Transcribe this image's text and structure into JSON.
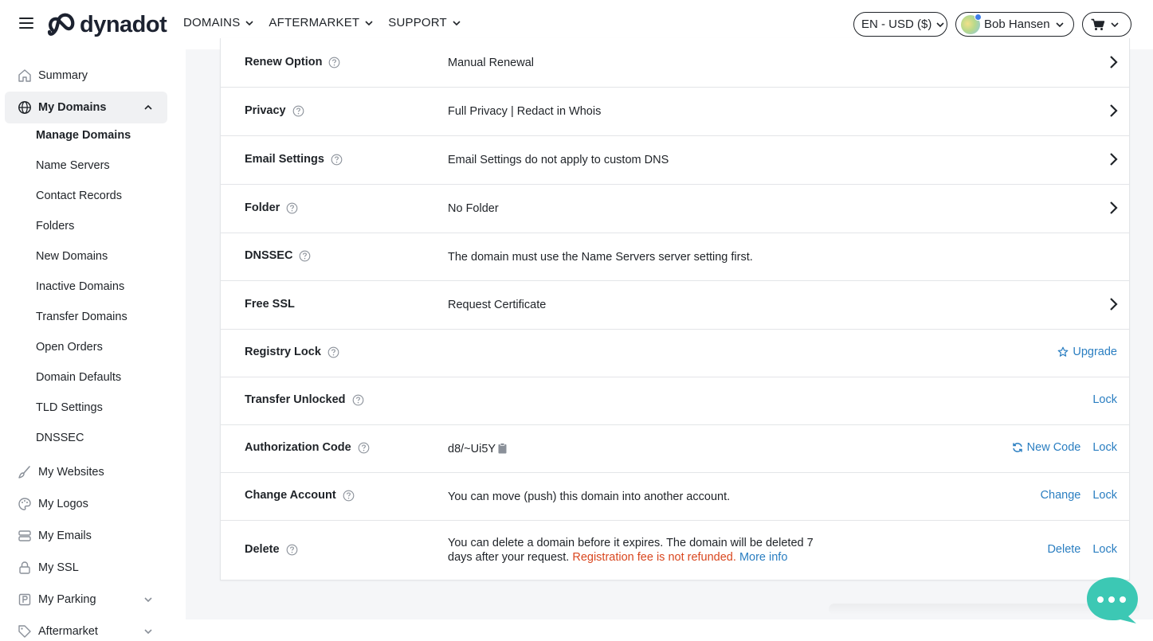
{
  "header": {
    "logo_text": "dynadot",
    "nav": [
      {
        "label": "DOMAINS"
      },
      {
        "label": "AFTERMARKET"
      },
      {
        "label": "SUPPORT"
      }
    ],
    "language_currency": "EN - USD ($)",
    "user_name": "Bob Hansen",
    "icons": {
      "menu": "hamburger-icon",
      "cart": "cart-icon",
      "dropdown": "chevron-down-icon"
    }
  },
  "sidebar": {
    "items": [
      {
        "label": "Summary",
        "icon": "home-icon"
      },
      {
        "label": "My Domains",
        "icon": "globe-icon",
        "expanded": true
      },
      {
        "label": "My Websites",
        "icon": "brush-icon"
      },
      {
        "label": "My Logos",
        "icon": "palette-icon"
      },
      {
        "label": "My Emails",
        "icon": "server-icon"
      },
      {
        "label": "My SSL",
        "icon": "lock-icon"
      },
      {
        "label": "My Parking",
        "icon": "parking-icon"
      },
      {
        "label": "Aftermarket",
        "icon": "tag-icon"
      }
    ],
    "domains_submenu": [
      {
        "label": "Manage Domains",
        "current": true
      },
      {
        "label": "Name Servers"
      },
      {
        "label": "Contact Records"
      },
      {
        "label": "Folders"
      },
      {
        "label": "New Domains"
      },
      {
        "label": "Inactive Domains"
      },
      {
        "label": "Transfer Domains"
      },
      {
        "label": "Open Orders"
      },
      {
        "label": "Domain Defaults"
      },
      {
        "label": "TLD Settings"
      },
      {
        "label": "DNSSEC"
      }
    ]
  },
  "settings": {
    "renew_option": {
      "label": "Renew Option",
      "value": "Manual Renewal"
    },
    "privacy": {
      "label": "Privacy",
      "value": "Full Privacy | Redact in Whois"
    },
    "email_settings": {
      "label": "Email Settings",
      "value": "Email Settings do not apply to custom DNS"
    },
    "folder": {
      "label": "Folder",
      "value": "No Folder"
    },
    "dnssec": {
      "label": "DNSSEC",
      "value": "The domain must use the Name Servers server setting first."
    },
    "free_ssl": {
      "label": "Free SSL",
      "value": "Request Certificate"
    },
    "registry_lock": {
      "label": "Registry Lock",
      "action": "Upgrade"
    },
    "transfer_unlocked": {
      "label": "Transfer Unlocked",
      "action": "Lock"
    },
    "authorization_code": {
      "label": "Authorization Code",
      "value": "d8/~Ui5Y",
      "new_code": "New Code",
      "lock": "Lock"
    },
    "change_account": {
      "label": "Change Account",
      "value": "You can move (push) this domain into another account.",
      "change": "Change",
      "lock": "Lock"
    },
    "delete": {
      "label": "Delete",
      "line1": "You can delete a domain before it expires. The domain will be deleted 7",
      "line2": "days after your request.",
      "warning": "Registration fee is not refunded.",
      "more_info": "More info",
      "delete": "Delete",
      "lock": "Lock"
    }
  },
  "colors": {
    "link": "#2a7ec1",
    "warning": "#d9471f",
    "chat": "#3cc8b4",
    "active_bg": "#f0f1f3"
  }
}
